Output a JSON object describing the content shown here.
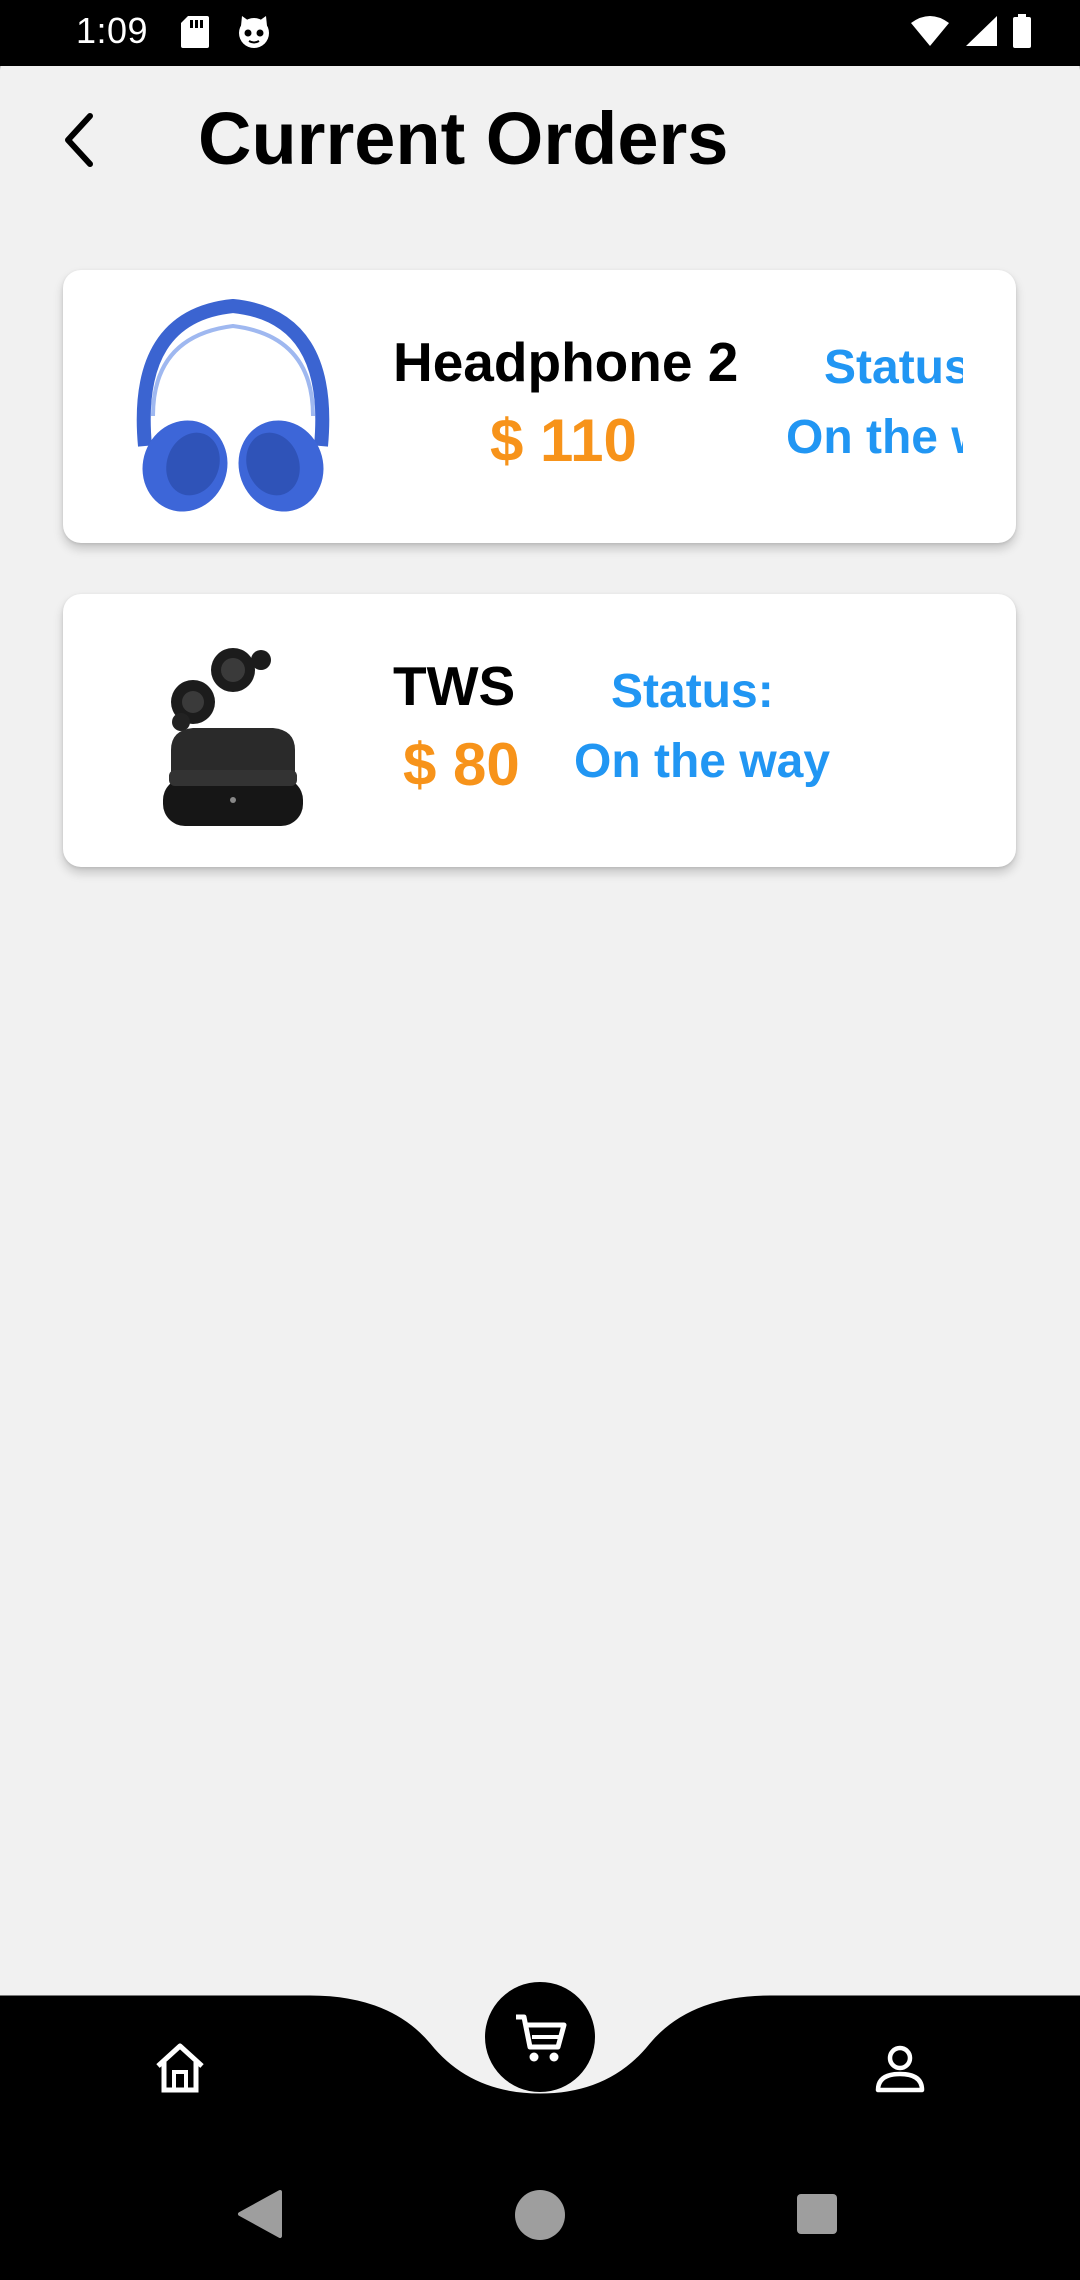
{
  "status_bar": {
    "time": "1:09",
    "left_icons": [
      "sd-card-icon",
      "cat-face-icon"
    ],
    "right_icons": [
      "wifi-icon",
      "cellular-signal-icon",
      "battery-icon"
    ]
  },
  "header": {
    "back_icon": "chevron-left-icon",
    "title": "Current Orders"
  },
  "orders": [
    {
      "name": "Headphone 2",
      "price": "$ 110",
      "status_label": "Status:",
      "status_value": "On the way",
      "image": "blue-headphones-image"
    },
    {
      "name": "TWS",
      "price": "$ 80",
      "status_label": "Status:",
      "status_value": "On the way",
      "image": "black-earbuds-image"
    }
  ],
  "bottom_nav": {
    "items": [
      "home-icon",
      "cart-icon",
      "profile-icon"
    ]
  },
  "system_nav": [
    "back-triangle",
    "home-circle",
    "recents-square"
  ],
  "colors": {
    "price": "#f7931a",
    "status": "#2196f3",
    "background": "#f1f1f1",
    "card": "#ffffff"
  }
}
